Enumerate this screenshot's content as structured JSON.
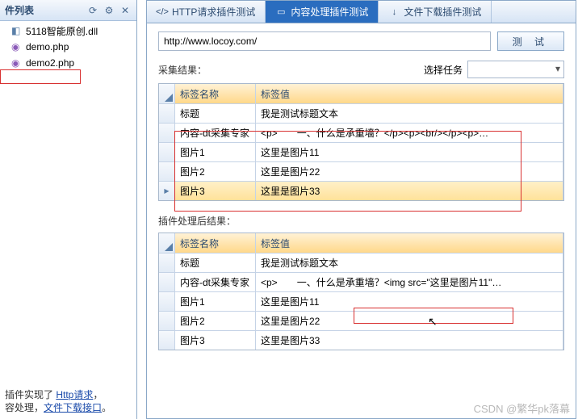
{
  "left": {
    "title": "件列表",
    "icons": {
      "refresh": "refresh-icon",
      "gear": "gear-icon",
      "close": "close-icon"
    },
    "files": [
      {
        "name": "5118智能原创.dll",
        "type": "dll"
      },
      {
        "name": "demo.php",
        "type": "php"
      },
      {
        "name": "demo2.php",
        "type": "php",
        "selected": true
      }
    ],
    "footer_line1_prefix": "插件实现了 ",
    "footer_line1_link": "Http请求",
    "footer_line1_suffix": "，",
    "footer_line2_prefix": "容处理，",
    "footer_line2_link": "文件下载接口",
    "footer_line2_suffix": "。"
  },
  "tabs": [
    {
      "id": "http",
      "label": "HTTP请求插件测试",
      "icon": "</>"
    },
    {
      "id": "content",
      "label": "内容处理插件测试",
      "icon": "▭",
      "active": true
    },
    {
      "id": "download",
      "label": "文件下载插件测试",
      "icon": "↓"
    }
  ],
  "url": {
    "value": "http://www.locoy.com/",
    "test_btn": "测 试"
  },
  "section1": {
    "label": "采集结果：",
    "task_label": "选择任务"
  },
  "section2": {
    "label": "插件处理后结果："
  },
  "grid_headers": {
    "name": "标签名称",
    "value": "标签值"
  },
  "grid1_rows": [
    {
      "name": "标题",
      "value": "我是测试标题文本"
    },
    {
      "name": "内容-dt采集专家",
      "value": "<p>　　一、什么是承重墙？</p><p><br/></p><p>…"
    },
    {
      "name": "图片1",
      "value": "这里是图片11"
    },
    {
      "name": "图片2",
      "value": "这里是图片22"
    },
    {
      "name": "图片3",
      "value": "这里是图片33",
      "selected": true
    }
  ],
  "grid2_rows": [
    {
      "name": "标题",
      "value": "我是测试标题文本"
    },
    {
      "name": "内容-dt采集专家",
      "value": "<p>　　一、什么是承重墙？<img src=\"这里是图片11\"…"
    },
    {
      "name": "图片1",
      "value": "这里是图片11"
    },
    {
      "name": "图片2",
      "value": "这里是图片22"
    },
    {
      "name": "图片3",
      "value": "这里是图片33"
    }
  ],
  "watermark": "CSDN @繁华pk落幕"
}
